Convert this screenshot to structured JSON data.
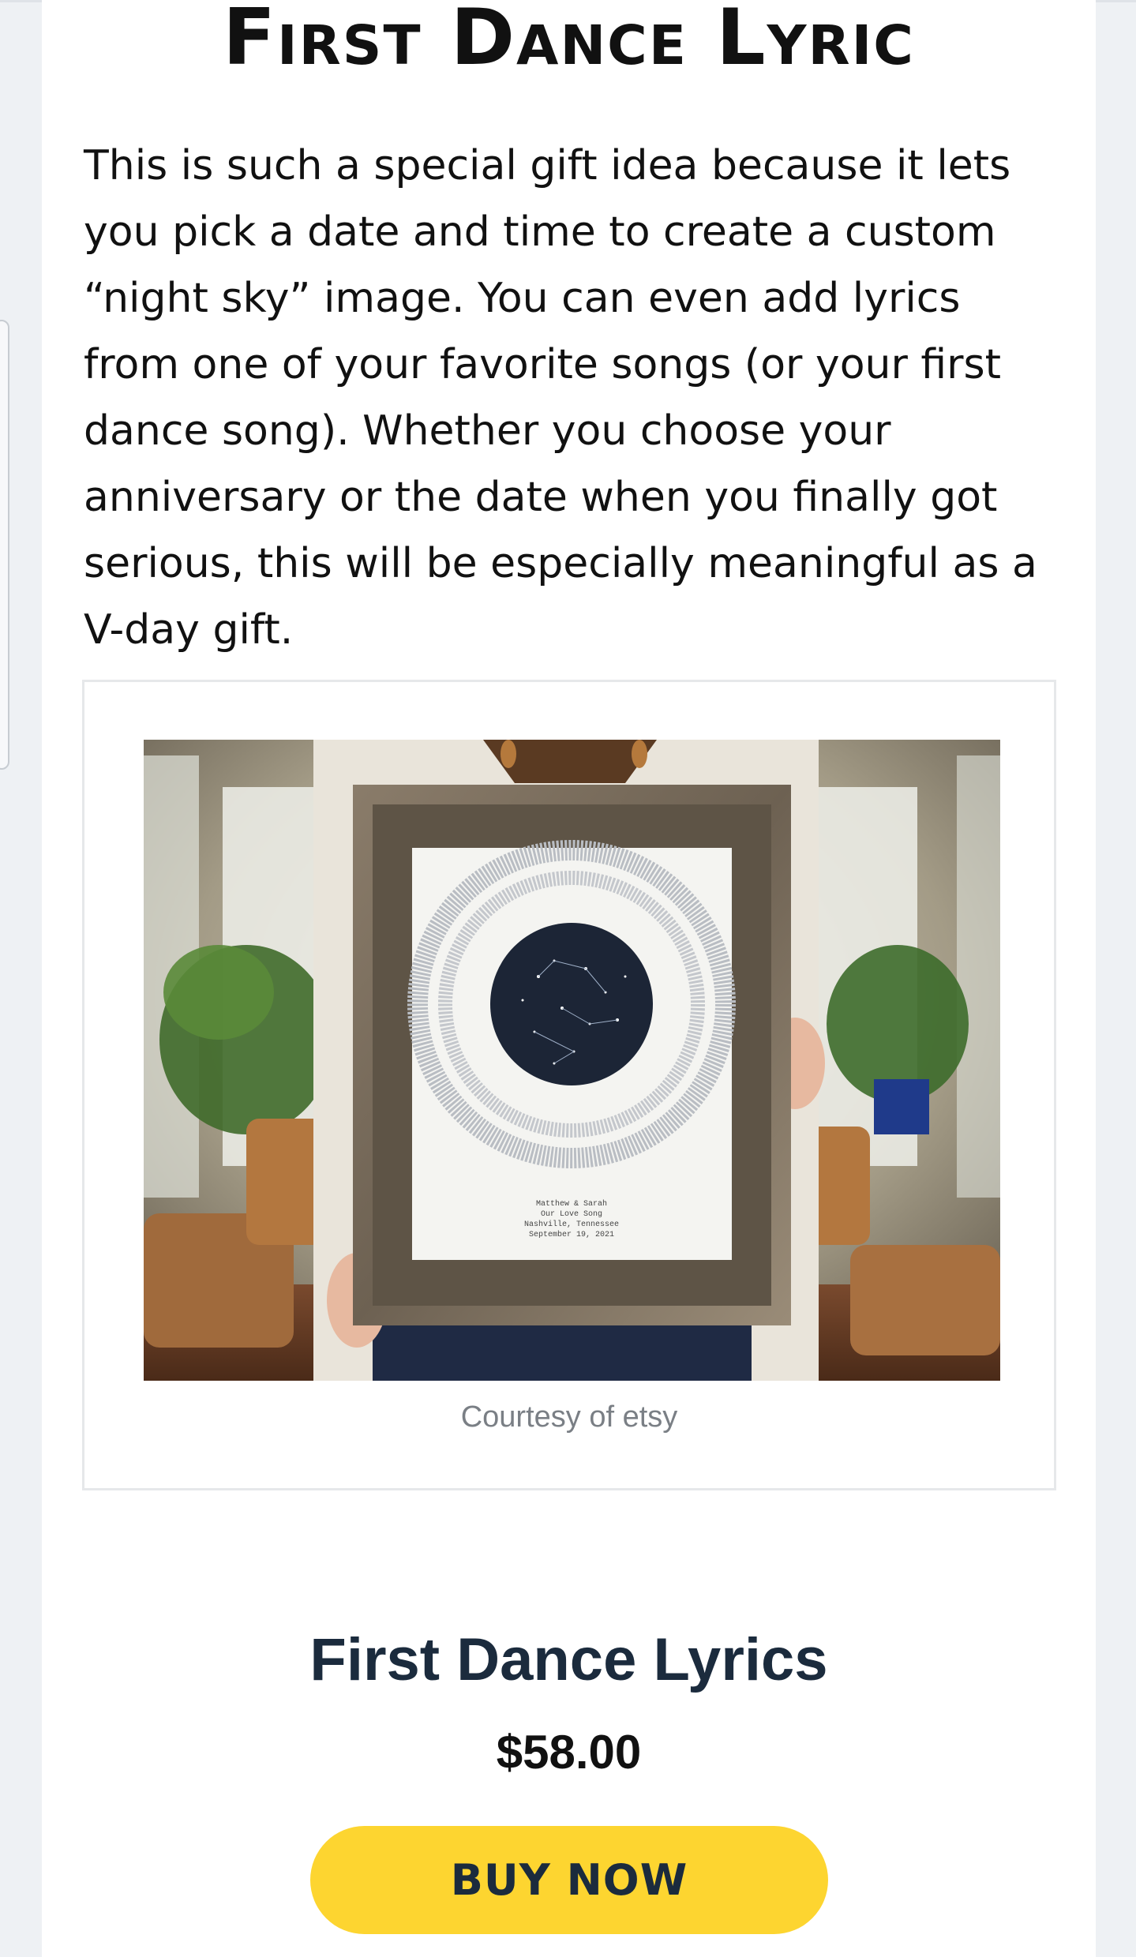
{
  "section": {
    "heading": "First Dance Lyric",
    "body": "This is such a special gift idea because it lets you pick a date and time to create a custom “night sky” image. You can even add lyrics from one of your favorite songs (or your first dance song). Whether you choose your anniversary or the date when you finally got serious, this will be especially meaningful as a V-day  gift."
  },
  "figure": {
    "image_icon": "framed-star-map-photo",
    "print_lines": [
      "Matthew & Sarah",
      "Our Love Song",
      "Nashville, Tennessee",
      "September 19, 2021"
    ],
    "caption": "Courtesy of etsy"
  },
  "product": {
    "title": "First Dance Lyrics",
    "price": "$58.00",
    "buy_label": "BUY NOW"
  },
  "colors": {
    "page_background": "#eef1f4",
    "card_background": "#ffffff",
    "heading_text": "#111111",
    "product_title": "#1b2b3d",
    "buy_button": "#fdd530",
    "caption_text": "#7a7f85"
  }
}
